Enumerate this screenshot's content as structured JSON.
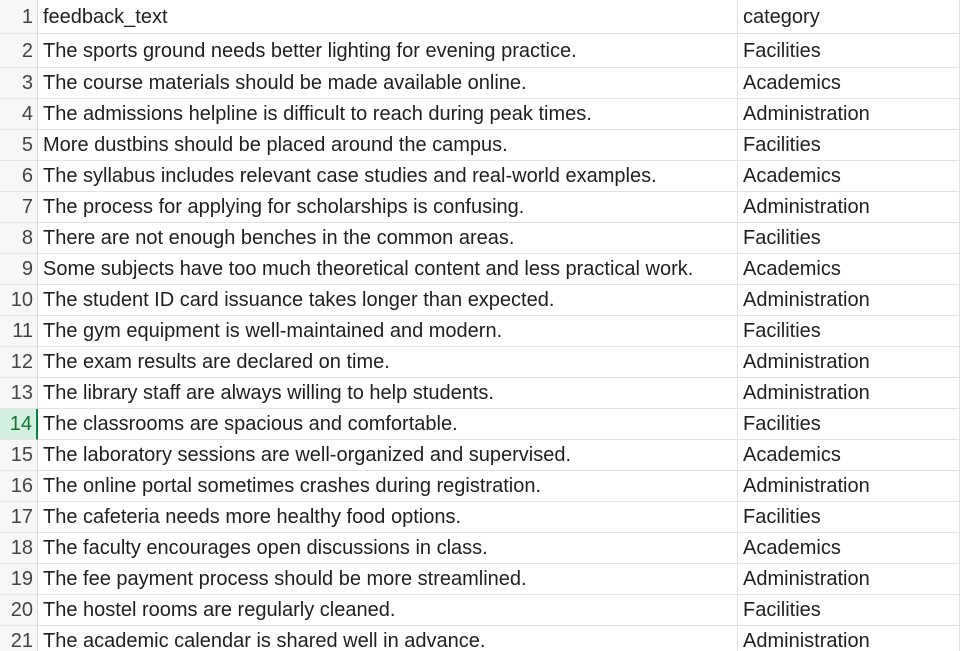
{
  "sheet": {
    "header": {
      "row_number": "1",
      "col_a": "feedback_text",
      "col_b": "category"
    },
    "selected_row": "14",
    "rows": [
      {
        "num": "2",
        "feedback": "The sports ground needs better lighting for evening practice.",
        "category": "Facilities"
      },
      {
        "num": "3",
        "feedback": "The course materials should be made available online.",
        "category": "Academics"
      },
      {
        "num": "4",
        "feedback": "The admissions helpline is difficult to reach during peak times.",
        "category": "Administration"
      },
      {
        "num": "5",
        "feedback": "More dustbins should be placed around the campus.",
        "category": "Facilities"
      },
      {
        "num": "6",
        "feedback": "The syllabus includes relevant case studies and real-world examples.",
        "category": "Academics"
      },
      {
        "num": "7",
        "feedback": "The process for applying for scholarships is confusing.",
        "category": "Administration"
      },
      {
        "num": "8",
        "feedback": "There are not enough benches in the common areas.",
        "category": "Facilities"
      },
      {
        "num": "9",
        "feedback": "Some subjects have too much theoretical content and less practical work.",
        "category": "Academics"
      },
      {
        "num": "10",
        "feedback": "The student ID card issuance takes longer than expected.",
        "category": "Administration"
      },
      {
        "num": "11",
        "feedback": "The gym equipment is well-maintained and modern.",
        "category": "Facilities"
      },
      {
        "num": "12",
        "feedback": "The exam results are declared on time.",
        "category": "Administration"
      },
      {
        "num": "13",
        "feedback": "The library staff are always willing to help students.",
        "category": "Administration"
      },
      {
        "num": "14",
        "feedback": "The classrooms are spacious and comfortable.",
        "category": "Facilities"
      },
      {
        "num": "15",
        "feedback": "The laboratory sessions are well-organized and supervised.",
        "category": "Academics"
      },
      {
        "num": "16",
        "feedback": "The online portal sometimes crashes during registration.",
        "category": "Administration"
      },
      {
        "num": "17",
        "feedback": "The cafeteria needs more healthy food options.",
        "category": "Facilities"
      },
      {
        "num": "18",
        "feedback": "The faculty encourages open discussions in class.",
        "category": "Academics"
      },
      {
        "num": "19",
        "feedback": "The fee payment process should be more streamlined.",
        "category": "Administration"
      },
      {
        "num": "20",
        "feedback": "The hostel rooms are regularly cleaned.",
        "category": "Facilities"
      },
      {
        "num": "21",
        "feedback": "The academic calendar is shared well in advance.",
        "category": "Administration"
      }
    ]
  }
}
